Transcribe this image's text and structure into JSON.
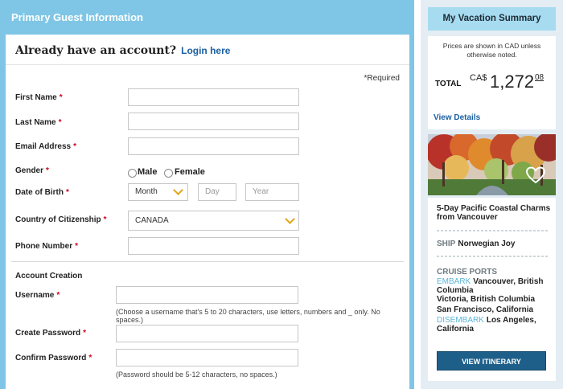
{
  "left": {
    "header": "Primary Guest Information",
    "account_question": "Already have an account?",
    "login_link": "Login here",
    "required_note": "*Required",
    "fields": {
      "first_name": "First Name",
      "last_name": "Last Name",
      "email": "Email Address",
      "gender": "Gender",
      "dob": "Date of Birth",
      "country": "Country of Citizenship",
      "phone": "Phone Number"
    },
    "required_mark": "*",
    "gender_options": [
      "Male",
      "Female"
    ],
    "dob": {
      "month_value": "Month",
      "day_placeholder": "Day",
      "year_placeholder": "Year"
    },
    "country_value": "CANADA",
    "account_creation": {
      "title": "Account Creation",
      "username": "Username",
      "username_hint": "(Choose a username that's 5 to 20 characters, use letters, numbers and _ only. No spaces.)",
      "create_password": "Create Password",
      "confirm_password": "Confirm Password",
      "password_hint": "(Password should be 5-12 characters, no spaces.)"
    }
  },
  "summary": {
    "header": "My Vacation Summary",
    "cad_note": "Prices are shown in CAD unless otherwise noted.",
    "total_label": "TOTAL",
    "currency": "CA$",
    "amount": "1,272",
    "cents": "08",
    "view_details": "View Details",
    "trip_title": "5-Day Pacific Coastal Charms from Vancouver",
    "ship_key": "SHIP",
    "ship_name": "Norwegian Joy",
    "ports_title": "CRUISE PORTS",
    "embark_key": "EMBARK",
    "embark_port": "Vancouver, British Columbia",
    "port_2": "Victoria, British Columbia",
    "port_3": "San Francisco, California",
    "disembark_key": "DISEMBARK",
    "disembark_port": "Los Angeles, California",
    "itinerary_button": "VIEW ITINERARY"
  },
  "icons": {
    "favorite": "heart-icon",
    "dropdown": "chevron-down-icon"
  },
  "colors": {
    "panel_blue": "#7fc6e6",
    "summary_header": "#a6dbf0",
    "link": "#1b5fa0",
    "required": "#d0021b",
    "chevron": "#e2a516",
    "button": "#1e5f8a"
  }
}
